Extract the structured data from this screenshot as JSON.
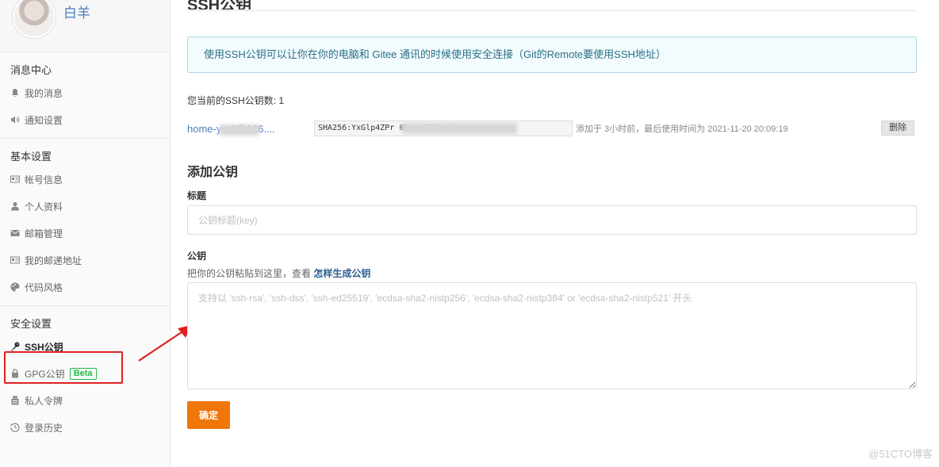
{
  "profile": {
    "username": "白羊"
  },
  "sidebar": {
    "sections": [
      {
        "title": "消息中心",
        "items": [
          {
            "label": "我的消息",
            "icon": "bell-icon"
          },
          {
            "label": "通知设置",
            "icon": "speaker-icon"
          }
        ]
      },
      {
        "title": "基本设置",
        "items": [
          {
            "label": "帐号信息",
            "icon": "id-card-icon"
          },
          {
            "label": "个人资料",
            "icon": "user-icon"
          },
          {
            "label": "邮箱管理",
            "icon": "mail-icon"
          },
          {
            "label": "我的邮递地址",
            "icon": "address-card-icon"
          },
          {
            "label": "代码风格",
            "icon": "palette-icon"
          }
        ]
      },
      {
        "title": "安全设置",
        "items": [
          {
            "label": "SSH公钥",
            "icon": "key-icon",
            "active": true
          },
          {
            "label": "GPG公钥",
            "icon": "lock-icon",
            "badge": "Beta"
          },
          {
            "label": "私人令牌",
            "icon": "token-icon"
          },
          {
            "label": "登录历史",
            "icon": "history-icon"
          }
        ]
      }
    ]
  },
  "main": {
    "page_title": "SSH公钥",
    "info_text": "使用SSH公钥可以让你在你的电脑和 Gitee 通讯的时候使用安全连接（Git的Remote要使用SSH地址）",
    "key_count_text": "您当前的SSH公钥数: 1",
    "key": {
      "name": "home-y        n9@126....",
      "fingerprint": "SHA256:YxGlp4ZPr                          0LxszXD8xzk",
      "meta": "添加于 3小时前，最后使用时间为 2021-11-20 20:09:19",
      "delete_label": "删除"
    },
    "add_title": "添加公钥",
    "title_label": "标题",
    "title_placeholder": "公钥标题(key)",
    "key_label": "公钥",
    "help_text": "把你的公钥粘贴到这里，查看 ",
    "help_link": "怎样生成公钥",
    "key_placeholder": "支持以 'ssh-rsa', 'ssh-dss', 'ssh-ed25519', 'ecdsa-sha2-nistp256', 'ecdsa-sha2-nistp384' or 'ecdsa-sha2-nistp521' 开头",
    "submit_label": "确定"
  },
  "watermark": "@51CTO博客",
  "colors": {
    "accent": "#f0760a",
    "highlight": "#e02020",
    "link": "#4a7ebb",
    "beta": "#21ba45"
  }
}
